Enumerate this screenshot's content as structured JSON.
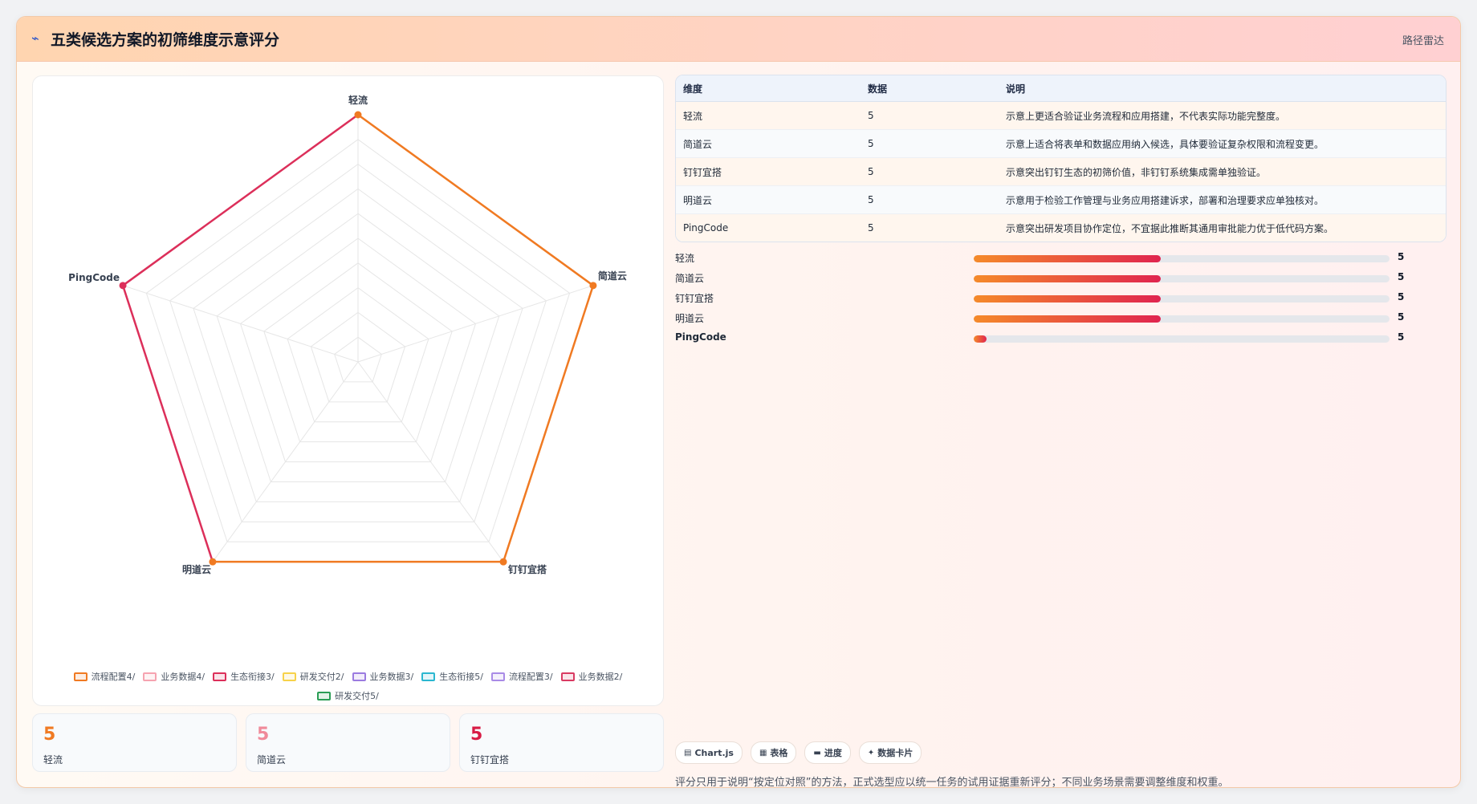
{
  "header": {
    "icon": "chart-line-icon",
    "title": "五类候选方案的初筛维度示意评分",
    "action": "路径雷达"
  },
  "chart_data": {
    "type": "radar",
    "axes": [
      "轻流",
      "简道云",
      "钉钉宜搭",
      "明道云",
      "PingCode"
    ],
    "r_range": [
      0,
      5
    ],
    "grid_levels": 10,
    "series": [
      {
        "name": "流程配置4/",
        "color": "#f07a22",
        "values": [
          5,
          5,
          5,
          5,
          null
        ]
      },
      {
        "name": "业务数据4/",
        "color": "#f6a3b0",
        "values": [
          null,
          null,
          null,
          null,
          null
        ]
      },
      {
        "name": "生态衔接3/",
        "color": "#dc2f5a",
        "values": [
          5,
          null,
          null,
          5,
          5
        ]
      },
      {
        "name": "研发交付2/",
        "color": "#f7d24a",
        "values": [
          null,
          null,
          null,
          null,
          null
        ]
      },
      {
        "name": "业务数据3/",
        "color": "#9b7be0",
        "values": [
          null,
          null,
          null,
          null,
          null
        ]
      },
      {
        "name": "生态衔接5/",
        "color": "#2bb7d0",
        "values": [
          null,
          null,
          null,
          null,
          null
        ]
      },
      {
        "name": "流程配置3/",
        "color": "#a98be6",
        "values": [
          null,
          null,
          null,
          null,
          null
        ]
      },
      {
        "name": "业务数据2/",
        "color": "#d93a62",
        "values": [
          null,
          null,
          null,
          null,
          null
        ]
      },
      {
        "name": "研发交付5/",
        "color": "#2a9d55",
        "values": [
          null,
          null,
          null,
          null,
          null
        ]
      }
    ],
    "legend": "bottom"
  },
  "table": {
    "headers": [
      "维度",
      "数据",
      "说明"
    ],
    "rows": [
      [
        "轻流",
        "5",
        "示意上更适合验证业务流程和应用搭建，不代表实际功能完整度。"
      ],
      [
        "简道云",
        "5",
        "示意上适合将表单和数据应用纳入候选，具体要验证复杂权限和流程变更。"
      ],
      [
        "钉钉宜搭",
        "5",
        "示意突出钉钉生态的初筛价值，非钉钉系统集成需单独验证。"
      ],
      [
        "明道云",
        "5",
        "示意用于检验工作管理与业务应用搭建诉求，部署和治理要求应单独核对。"
      ],
      [
        "PingCode",
        "5",
        "示意突出研发项目协作定位，不宜据此推断其通用审批能力优于低代码方案。"
      ]
    ]
  },
  "bars": [
    {
      "label": "轻流",
      "value": "5",
      "fill": 0.45,
      "bold": false
    },
    {
      "label": "简道云",
      "value": "5",
      "fill": 0.45,
      "bold": false
    },
    {
      "label": "钉钉宜搭",
      "value": "5",
      "fill": 0.45,
      "bold": false
    },
    {
      "label": "明道云",
      "value": "5",
      "fill": 0.45,
      "bold": false
    },
    {
      "label": "PingCode",
      "value": "5",
      "fill": 0.03,
      "bold": true
    }
  ],
  "stat_cards": [
    {
      "value": "5",
      "label": "轻流",
      "color": "#f07a22"
    },
    {
      "value": "5",
      "label": "简道云",
      "color": "#f08a9a"
    },
    {
      "value": "5",
      "label": "钉钉宜搭",
      "color": "#d81b45"
    }
  ],
  "tags": [
    {
      "icon": "chart-icon",
      "glyph": "▤",
      "label": "Chart.js"
    },
    {
      "icon": "table-icon",
      "glyph": "▦",
      "label": "表格"
    },
    {
      "icon": "progress-icon",
      "glyph": "▬",
      "label": "进度"
    },
    {
      "icon": "card-icon",
      "glyph": "✦",
      "label": "数据卡片"
    }
  ],
  "footnote": "评分只用于说明“按定位对照”的方法，正式选型应以统一任务的试用证据重新评分；不同业务场景需要调整维度和权重。"
}
